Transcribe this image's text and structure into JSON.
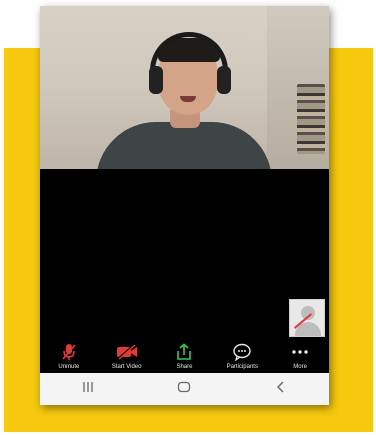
{
  "toolbar": {
    "unmute": {
      "label": "Unmute",
      "icon": "muted-microphone-icon"
    },
    "start_video": {
      "label": "Start Video",
      "icon": "video-off-icon"
    },
    "share": {
      "label": "Share",
      "icon": "share-icon"
    },
    "participants": {
      "label": "Participants",
      "icon": "participants-chat-icon"
    },
    "more": {
      "label": "More",
      "icon": "more-dots-icon"
    }
  },
  "navbar": {
    "recent": {
      "icon": "recent-apps-icon"
    },
    "home": {
      "icon": "home-icon"
    },
    "back": {
      "icon": "back-icon"
    }
  },
  "colors": {
    "accent_red": "#e53935",
    "share_green": "#37c84a",
    "background_yellow": "#f6c90e"
  }
}
